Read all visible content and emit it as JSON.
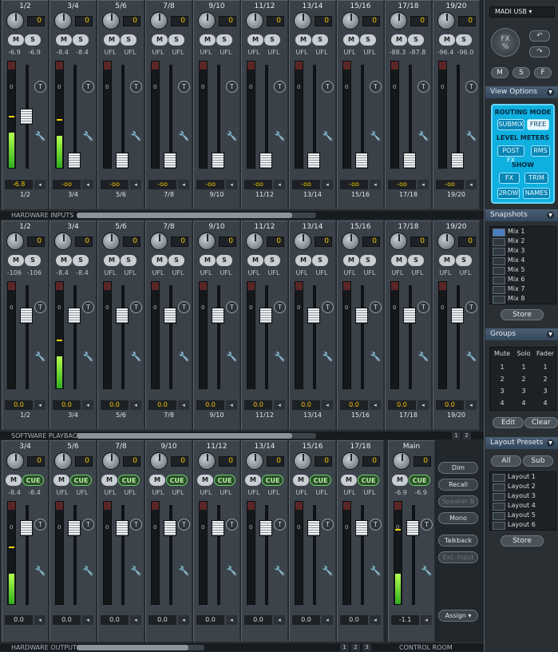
{
  "inputs": {
    "section": "HARDWARE INPUTS",
    "channels": [
      {
        "label": "1/2",
        "gain": "0",
        "peak_l": "-6.9",
        "peak_r": "-6.9",
        "level": "-6.8",
        "bottom": "1/2",
        "meter": 0.33,
        "peak_mark": 0.47,
        "fader": 0.5
      },
      {
        "label": "3/4",
        "gain": "0",
        "peak_l": "-8.4",
        "peak_r": "-8.4",
        "level": "-oo",
        "bottom": "3/4",
        "meter": 0.3,
        "peak_mark": 0.44,
        "fader": 0.0
      },
      {
        "label": "5/6",
        "gain": "0",
        "peak_l": "UFL",
        "peak_r": "UFL",
        "level": "-oo",
        "bottom": "5/6",
        "meter": 0,
        "peak_mark": null,
        "fader": 0.0
      },
      {
        "label": "7/8",
        "gain": "0",
        "peak_l": "UFL",
        "peak_r": "UFL",
        "level": "-oo",
        "bottom": "7/8",
        "meter": 0,
        "peak_mark": null,
        "fader": 0.0
      },
      {
        "label": "9/10",
        "gain": "0",
        "peak_l": "UFL",
        "peak_r": "UFL",
        "level": "-oo",
        "bottom": "9/10",
        "meter": 0,
        "peak_mark": null,
        "fader": 0.0
      },
      {
        "label": "11/12",
        "gain": "0",
        "peak_l": "UFL",
        "peak_r": "UFL",
        "level": "-oo",
        "bottom": "11/12",
        "meter": 0,
        "peak_mark": null,
        "fader": 0.0
      },
      {
        "label": "13/14",
        "gain": "0",
        "peak_l": "UFL",
        "peak_r": "UFL",
        "level": "-oo",
        "bottom": "13/14",
        "meter": 0,
        "peak_mark": null,
        "fader": 0.0
      },
      {
        "label": "15/16",
        "gain": "0",
        "peak_l": "UFL",
        "peak_r": "UFL",
        "level": "-oo",
        "bottom": "15/16",
        "meter": 0,
        "peak_mark": null,
        "fader": 0.0
      },
      {
        "label": "17/18",
        "gain": "0",
        "peak_l": "-88.3",
        "peak_r": "-87.8",
        "level": "-oo",
        "bottom": "17/18",
        "meter": 0,
        "peak_mark": null,
        "fader": 0.0
      },
      {
        "label": "19/20",
        "gain": "0",
        "peak_l": "-96.4",
        "peak_r": "-96.0",
        "level": "-oo",
        "bottom": "19/20",
        "meter": 0,
        "peak_mark": null,
        "fader": 0.0
      }
    ]
  },
  "playback": {
    "section": "SOFTWARE PLAYBACK",
    "channels": [
      {
        "label": "1/2",
        "gain": "0",
        "peak_l": "-106",
        "peak_r": "-106",
        "level": "0.0",
        "bottom": "1/2",
        "meter": 0,
        "peak_mark": null,
        "fader": 0.75
      },
      {
        "label": "3/4",
        "gain": "0",
        "peak_l": "-8.4",
        "peak_r": "-8.4",
        "level": "0.0",
        "bottom": "3/4",
        "meter": 0.3,
        "peak_mark": 0.44,
        "fader": 0.75
      },
      {
        "label": "5/6",
        "gain": "0",
        "peak_l": "UFL",
        "peak_r": "UFL",
        "level": "0.0",
        "bottom": "5/6",
        "meter": 0,
        "peak_mark": null,
        "fader": 0.75
      },
      {
        "label": "7/8",
        "gain": "0",
        "peak_l": "UFL",
        "peak_r": "UFL",
        "level": "0.0",
        "bottom": "7/8",
        "meter": 0,
        "peak_mark": null,
        "fader": 0.75
      },
      {
        "label": "9/10",
        "gain": "0",
        "peak_l": "UFL",
        "peak_r": "UFL",
        "level": "0.0",
        "bottom": "9/10",
        "meter": 0,
        "peak_mark": null,
        "fader": 0.75
      },
      {
        "label": "11/12",
        "gain": "0",
        "peak_l": "UFL",
        "peak_r": "UFL",
        "level": "0.0",
        "bottom": "11/12",
        "meter": 0,
        "peak_mark": null,
        "fader": 0.75
      },
      {
        "label": "13/14",
        "gain": "0",
        "peak_l": "UFL",
        "peak_r": "UFL",
        "level": "0.0",
        "bottom": "13/14",
        "meter": 0,
        "peak_mark": null,
        "fader": 0.75
      },
      {
        "label": "15/16",
        "gain": "0",
        "peak_l": "UFL",
        "peak_r": "UFL",
        "level": "0.0",
        "bottom": "15/16",
        "meter": 0,
        "peak_mark": null,
        "fader": 0.75
      },
      {
        "label": "17/18",
        "gain": "0",
        "peak_l": "UFL",
        "peak_r": "UFL",
        "level": "0.0",
        "bottom": "17/18",
        "meter": 0,
        "peak_mark": null,
        "fader": 0.75
      },
      {
        "label": "19/20",
        "gain": "0",
        "peak_l": "UFL",
        "peak_r": "UFL",
        "level": "0.0",
        "bottom": "19/20",
        "meter": 0,
        "peak_mark": null,
        "fader": 0.75
      }
    ],
    "pages": [
      "1",
      "2"
    ]
  },
  "outputs": {
    "section": "HARDWARE OUTPUTS",
    "control_room": "CONTROL ROOM",
    "channels": [
      {
        "label": "3/4",
        "gain": "0",
        "peak_l": "-8.4",
        "peak_r": "-8.4",
        "level": "0.0",
        "meter": 0.3,
        "peak_mark": 0.55,
        "fader": 0.82
      },
      {
        "label": "5/6",
        "gain": "0",
        "peak_l": "UFL",
        "peak_r": "UFL",
        "level": "0.0",
        "meter": 0,
        "peak_mark": null,
        "fader": 0.82
      },
      {
        "label": "7/8",
        "gain": "0",
        "peak_l": "UFL",
        "peak_r": "UFL",
        "level": "0.0",
        "meter": 0,
        "peak_mark": null,
        "fader": 0.82
      },
      {
        "label": "9/10",
        "gain": "0",
        "peak_l": "UFL",
        "peak_r": "UFL",
        "level": "0.0",
        "meter": 0,
        "peak_mark": null,
        "fader": 0.82
      },
      {
        "label": "11/12",
        "gain": "0",
        "peak_l": "UFL",
        "peak_r": "UFL",
        "level": "0.0",
        "meter": 0,
        "peak_mark": null,
        "fader": 0.82
      },
      {
        "label": "13/14",
        "gain": "0",
        "peak_l": "UFL",
        "peak_r": "UFL",
        "level": "0.0",
        "meter": 0,
        "peak_mark": null,
        "fader": 0.82
      },
      {
        "label": "15/16",
        "gain": "0",
        "peak_l": "UFL",
        "peak_r": "UFL",
        "level": "0.0",
        "meter": 0,
        "peak_mark": null,
        "fader": 0.82
      },
      {
        "label": "17/18",
        "gain": "0",
        "peak_l": "UFL",
        "peak_r": "UFL",
        "level": "0.0",
        "meter": 0,
        "peak_mark": null,
        "fader": 0.82
      }
    ],
    "main": {
      "label": "Main",
      "gain": "0",
      "peak_l": "-6.9",
      "peak_r": "-6.9",
      "level": "-1.1",
      "meter": 0.3,
      "peak_mark": 0.72,
      "fader": 0.82
    },
    "controls": [
      "Dim",
      "Recall",
      "Speaker B",
      "Mono",
      "Talkback",
      "Ext. Input"
    ],
    "assign": "Assign",
    "pages": [
      "1",
      "2",
      "3"
    ]
  },
  "buttons": {
    "mute": "M",
    "solo": "S",
    "cue": "CUE",
    "trim": "T"
  },
  "side": {
    "device": "MADI USB",
    "fx": "FX",
    "fx_unit": "%",
    "msf": [
      "M",
      "S",
      "F"
    ],
    "view_options": "View Options",
    "routing_mode": "ROUTING MODE",
    "submix": "SUBMIX",
    "free": "FREE",
    "level_meters": "LEVEL METERS",
    "postfx": "POST FX",
    "rms": "RMS",
    "show": "SHOW",
    "fx_btn": "FX",
    "trim": "TRIM",
    "tworow": "2ROW",
    "names": "NAMES",
    "snapshots": "Snapshots",
    "snapshot_items": [
      "Mix 1",
      "Mix 2",
      "Mix 3",
      "Mix 4",
      "Mix 5",
      "Mix 6",
      "Mix 7",
      "Mix 8"
    ],
    "store": "Store",
    "groups": "Groups",
    "group_cols": [
      "Mute",
      "Solo",
      "Fader"
    ],
    "group_rows": [
      [
        "1",
        "1",
        "1"
      ],
      [
        "2",
        "2",
        "2"
      ],
      [
        "3",
        "3",
        "3"
      ],
      [
        "4",
        "4",
        "4"
      ]
    ],
    "edit": "Edit",
    "clear": "Clear",
    "layout_presets": "Layout Presets",
    "all": "All",
    "sub": "Sub",
    "layout_items": [
      "Layout 1",
      "Layout 2",
      "Layout 3",
      "Layout 4",
      "Layout 5",
      "Layout 6"
    ],
    "store2": "Store"
  },
  "colors": {
    "meter_green": "#6fe13a",
    "accent_yellow": "#f4c400",
    "options_blue": "#0fb0e0"
  }
}
